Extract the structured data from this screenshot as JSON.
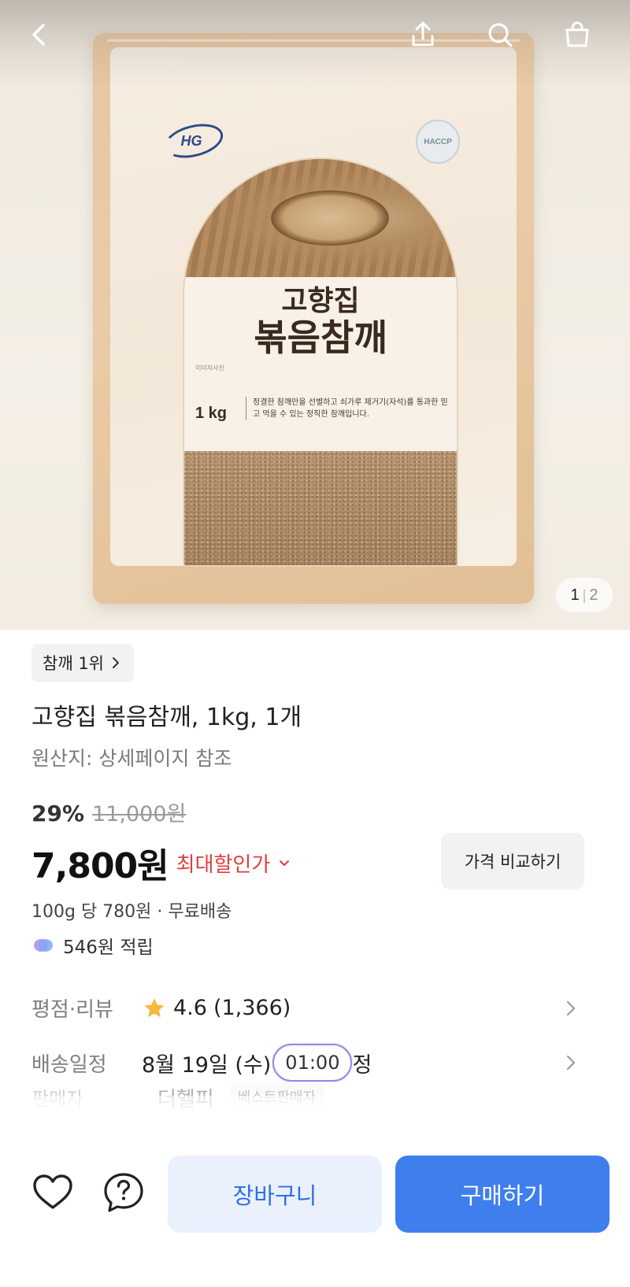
{
  "hero": {
    "package": {
      "brand": "HG",
      "certification": "HACCP",
      "title_line1": "고향집",
      "title_line2": "볶음참깨",
      "side_note": "이미지사진",
      "weight": "1 kg",
      "description": "정결한 참깨만을 선별하고 쇠가루 제거기(자석)를 통과한 믿고 먹을 수 있는 정직한 참깨입니다."
    },
    "pager": {
      "current": "1",
      "separator": "|",
      "total": "2"
    },
    "icons": {
      "back": "chevron-left-icon",
      "share": "share-icon",
      "search": "search-icon",
      "cart": "shopping-bag-icon"
    }
  },
  "product": {
    "rank_chip": "참깨 1위",
    "title": "고향집 볶음참깨, 1kg, 1개",
    "origin": "원산지: 상세페이지 참조",
    "discount": "29%",
    "original_price": "11,000원",
    "price": "7,800원",
    "max_discount_label": "최대할인가",
    "compare_button": "가격 비교하기",
    "unit_price_shipping": "100g 당 780원 · 무료배송",
    "points": "546원 적립"
  },
  "info": {
    "rating": {
      "label": "평점·리뷰",
      "score": "4.6",
      "count": "(1,366)"
    },
    "delivery": {
      "label": "배송일정",
      "date": "8월 19일 (수)",
      "time_pill": "01:00",
      "suffix": "정"
    },
    "seller": {
      "label": "판매자",
      "name": "더헬피",
      "badge": "베스트판매자"
    }
  },
  "bottom_bar": {
    "cart_button": "장바구니",
    "buy_button": "구매하기"
  },
  "colors": {
    "accent": "#3f7fed",
    "accent_light": "#eaf1fd",
    "discount_red": "#e23d3d",
    "star": "#f6b93b"
  }
}
